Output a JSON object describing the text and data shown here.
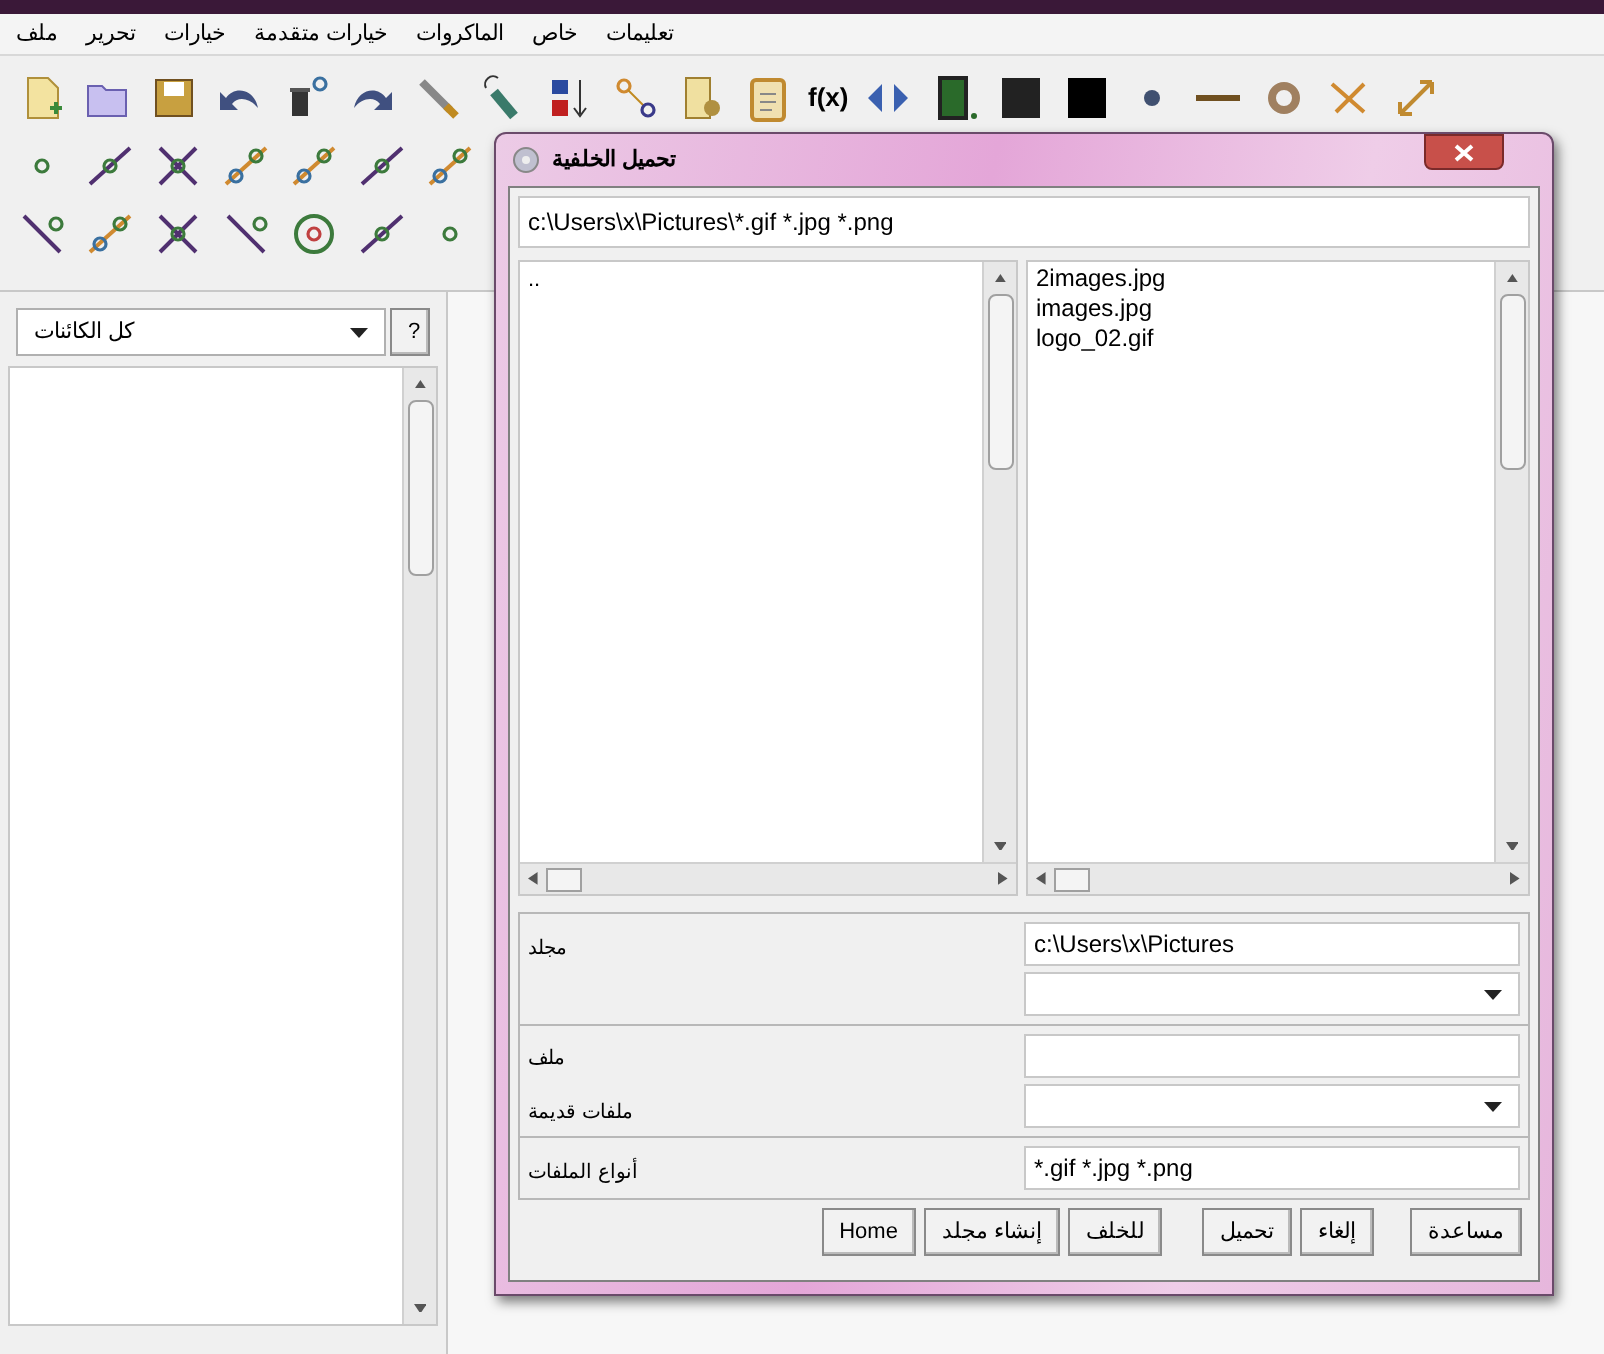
{
  "menu": [
    "تعليمات",
    "خاص",
    "الماكروات",
    "خيارات متقدمة",
    "خيارات",
    "تحرير",
    "ملف"
  ],
  "toolbar": {
    "function_label": "f(x)"
  },
  "objects_panel": {
    "filter": "كل الكائنات",
    "help_button": "?"
  },
  "dialog": {
    "title": "تحميل الخلفية",
    "path": "c:\\Users\\x\\Pictures\\*.gif *.jpg *.png",
    "folders": [
      ".."
    ],
    "files": [
      "2images.jpg",
      "images.jpg",
      "logo_02.gif"
    ],
    "folder_label": "مجلد",
    "folder_value": "c:\\Users\\x\\Pictures",
    "file_label": "ملف",
    "old_files_label": "ملفات قديمة",
    "types_label": "أنواع الملفات",
    "types_value": "*.gif *.jpg *.png",
    "right_buttons": [
      "مساعدة",
      "إلغاء",
      "تحميل"
    ],
    "left_buttons": [
      "للخلف",
      "إنشاء مجلد",
      "Home"
    ]
  }
}
